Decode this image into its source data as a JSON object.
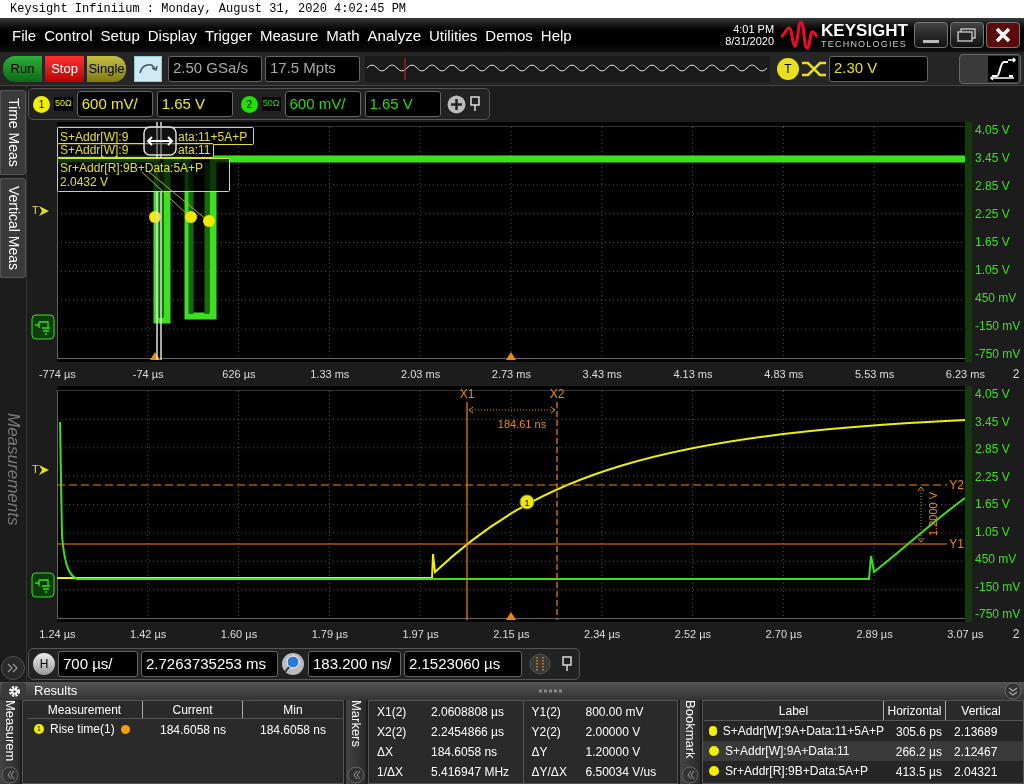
{
  "title_bar": "Keysight Infiniium : Monday, August 31, 2020 4:02:45 PM",
  "menu": [
    "File",
    "Control",
    "Setup",
    "Display",
    "Trigger",
    "Measure",
    "Math",
    "Analyze",
    "Utilities",
    "Demos",
    "Help"
  ],
  "clock": {
    "time": "4:01 PM",
    "date": "8/31/2020"
  },
  "logo": {
    "name": "KEYSIGHT",
    "tagline": "TECHNOLOGIES"
  },
  "acquisition": {
    "buttons": [
      {
        "label": "Run",
        "kind": "run"
      },
      {
        "label": "Stop",
        "kind": "stop"
      },
      {
        "label": "Single",
        "kind": "single"
      }
    ],
    "sample_rate": "2.50 GSa/s",
    "memory_depth": "17.5 Mpts"
  },
  "trigger": {
    "badge": "T",
    "level": "2.30 V"
  },
  "side_tabs": [
    "Time Meas",
    "Vertical Meas"
  ],
  "side_caption": "Measurements",
  "channels": [
    {
      "number": "1",
      "impedance": "50Ω",
      "scale": "600 mV/",
      "offset": "1.65 V",
      "color": "#f0f000"
    },
    {
      "number": "2",
      "impedance": "50Ω",
      "scale": "600 mV/",
      "offset": "1.65 V",
      "color": "#22e000"
    }
  ],
  "upper_plot": {
    "trigger_marker": "T",
    "y_labels": [
      "4.05 V",
      "3.45 V",
      "2.85 V",
      "2.25 V",
      "1.65 V",
      "1.05 V",
      "450 mV",
      "-150 mV",
      "-750 mV"
    ],
    "x_labels": [
      "-774 µs",
      "-74 µs",
      "626 µs",
      "1.33 ms",
      "2.03 ms",
      "2.73 ms",
      "3.43 ms",
      "4.13 ms",
      "4.83 ms",
      "5.53 ms",
      "6.23 ms"
    ],
    "edge_label": "2",
    "bookmarks": [
      {
        "kind": "split",
        "texts": [
          "S+Addr[W]:9",
          "ata:11+5A+P"
        ]
      },
      {
        "kind": "split",
        "texts": [
          "S+Addr[W]:9",
          "ata:11"
        ]
      },
      {
        "kind": "stacked",
        "texts": [
          "Sr+Addr[R]:9B+Data:5A+P",
          "2.0432 V"
        ]
      }
    ]
  },
  "lower_plot": {
    "trigger_marker": "T",
    "y_labels": [
      "4.05 V",
      "3.45 V",
      "2.85 V",
      "2.25 V",
      "1.65 V",
      "1.05 V",
      "450 mV",
      "-150 mV",
      "-750 mV"
    ],
    "x_labels": [
      "1.24 µs",
      "1.42 µs",
      "1.60 µs",
      "1.79 µs",
      "1.97 µs",
      "2.15 µs",
      "2.34 µs",
      "2.52 µs",
      "2.70 µs",
      "2.89 µs",
      "3.07 µs"
    ],
    "edge_label": "2",
    "markers": {
      "x1": "X1",
      "x2": "X2",
      "dx": "184.61 ns",
      "y1": "Y1",
      "y2": "Y2",
      "dy": "1.2000 V"
    },
    "measurement_marker": "1"
  },
  "horizontal": {
    "badge": "H",
    "scale": "700 µs/",
    "position": "2.7263735253 ms",
    "zoom_scale": "183.200 ns/",
    "zoom_position": "2.1523060 µs"
  },
  "results": {
    "title": "Results",
    "measurements": {
      "side_label": "Measurem",
      "columns": [
        "Measurement",
        "Current",
        "Min"
      ],
      "rows": [
        {
          "badge": "1",
          "name": "Rise time(1)",
          "current": "184.6058 ns",
          "min": "184.6058 ns"
        }
      ]
    },
    "markers": {
      "side_label": "Markers",
      "left": [
        {
          "label": "X1(2)",
          "value": "2.0608808 µs"
        },
        {
          "label": "X2(2)",
          "value": "2.2454866 µs"
        },
        {
          "label": "ΔX",
          "value": "184.6058 ns"
        },
        {
          "label": "1/ΔX",
          "value": "5.416947 MHz"
        }
      ],
      "right": [
        {
          "label": "Y1(2)",
          "value": "800.00 mV"
        },
        {
          "label": "Y2(2)",
          "value": "2.00000 V"
        },
        {
          "label": "ΔY",
          "value": "1.20000 V"
        },
        {
          "label": "ΔY/ΔX",
          "value": "6.50034 V/us"
        }
      ]
    },
    "bookmarks": {
      "side_label": "Bookmark",
      "columns": [
        "Label",
        "Horizontal",
        "Vertical"
      ],
      "rows": [
        {
          "label": "S+Addr[W]:9A+Data:11+5A+P",
          "horizontal": "305.6 ps",
          "vertical": "2.13689"
        },
        {
          "label": "S+Addr[W]:9A+Data:11",
          "horizontal": "266.2 µs",
          "vertical": "2.12467"
        },
        {
          "label": "Sr+Addr[R]:9B+Data:5A+P",
          "horizontal": "413.5 µs",
          "vertical": "2.04321"
        }
      ]
    }
  }
}
